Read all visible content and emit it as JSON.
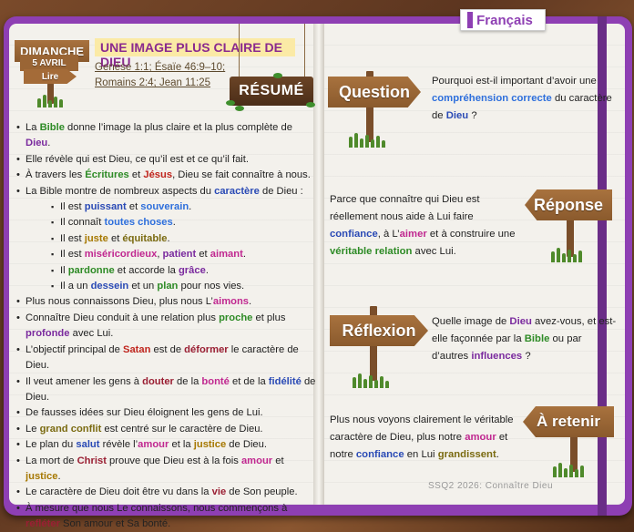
{
  "language_tab": "Français",
  "date_sign": {
    "day": "DIMANCHE",
    "date": "5 AVRIL",
    "action": "Lire"
  },
  "lesson": {
    "title": "UNE IMAGE PLUS CLAIRE DE DIEU",
    "refs_line1": "Genèse 1:1; Ésaïe 46:9–10;",
    "refs_line2": "Romains 2:4; Jean 11:25"
  },
  "resume_label": "RÉSUMÉ",
  "summary": [
    [
      "La ",
      {
        "t": "Bible",
        "c": "green"
      },
      " donne l’image la plus claire et la plus complète de ",
      {
        "t": "Dieu",
        "c": "purple"
      },
      "."
    ],
    [
      "Elle révèle qui est Dieu, ce qu’il est et ce qu’il fait."
    ],
    [
      "À travers les ",
      {
        "t": "Écritures",
        "c": "green"
      },
      " et ",
      {
        "t": "Jésus",
        "c": "red"
      },
      ", Dieu se fait connaître à nous."
    ],
    [
      "La Bible montre de nombreux aspects du ",
      {
        "t": "caractère",
        "c": "blue"
      },
      " de Dieu :"
    ]
  ],
  "attributes": [
    [
      "Il est ",
      {
        "t": "puissant",
        "c": "blue"
      },
      " et ",
      {
        "t": "souverain",
        "c": "lblue"
      },
      "."
    ],
    [
      "Il connaît ",
      {
        "t": "toutes choses",
        "c": "lblue"
      },
      "."
    ],
    [
      "Il est ",
      {
        "t": "juste",
        "c": "gold"
      },
      " et ",
      {
        "t": "équitable",
        "c": "olive"
      },
      "."
    ],
    [
      "Il est ",
      {
        "t": "miséricordieux",
        "c": "pink"
      },
      ", ",
      {
        "t": "patient",
        "c": "purple"
      },
      " et ",
      {
        "t": "aimant",
        "c": "pink"
      },
      "."
    ],
    [
      "Il ",
      {
        "t": "pardonne",
        "c": "green"
      },
      " et accorde la ",
      {
        "t": "grâce",
        "c": "purple"
      },
      "."
    ],
    [
      "Il a un ",
      {
        "t": "dessein",
        "c": "blue"
      },
      " et un ",
      {
        "t": "plan",
        "c": "green"
      },
      " pour nos vies."
    ]
  ],
  "summary2": [
    [
      "Plus nous connaissons Dieu, plus nous L’",
      {
        "t": "aimons",
        "c": "pink"
      },
      "."
    ],
    [
      "Connaître Dieu conduit à une relation plus ",
      {
        "t": "proche",
        "c": "green"
      },
      " et plus ",
      {
        "t": "profonde",
        "c": "purple"
      },
      " avec Lui."
    ],
    [
      "L’objectif principal de ",
      {
        "t": "Satan",
        "c": "red"
      },
      " est de ",
      {
        "t": "déformer",
        "c": "dkred"
      },
      " le caractère de Dieu."
    ],
    [
      "Il veut amener les gens à ",
      {
        "t": "douter",
        "c": "dkred"
      },
      " de la ",
      {
        "t": "bonté",
        "c": "pink"
      },
      " et de la ",
      {
        "t": "fidélité",
        "c": "blue"
      },
      " de Dieu."
    ],
    [
      "De fausses idées sur Dieu éloignent les gens de Lui."
    ],
    [
      "Le ",
      {
        "t": "grand conflit",
        "c": "olive"
      },
      " est centré sur le caractère de Dieu."
    ],
    [
      "Le plan du ",
      {
        "t": "salut",
        "c": "blue"
      },
      " révèle l’",
      {
        "t": "amour",
        "c": "pink"
      },
      " et la ",
      {
        "t": "justice",
        "c": "gold"
      },
      " de Dieu."
    ],
    [
      "La mort de ",
      {
        "t": "Christ",
        "c": "dkred"
      },
      " prouve que Dieu est à la fois ",
      {
        "t": "amour",
        "c": "pink"
      },
      " et ",
      {
        "t": "justice",
        "c": "gold"
      },
      "."
    ],
    [
      "Le caractère de Dieu doit être vu dans la ",
      {
        "t": "vie",
        "c": "dkred"
      },
      " de Son peuple."
    ],
    [
      "À mesure que nous Le connaissons, nous commençons à ",
      {
        "t": "refléter",
        "c": "dkred"
      },
      " Son amour et Sa bonté."
    ]
  ],
  "question": {
    "label": "Question",
    "text": [
      "Pourquoi est-il important d’avoir une ",
      {
        "t": "compréhension correcte",
        "c": "lblue"
      },
      " du caractère de ",
      {
        "t": "Dieu",
        "c": "blue"
      },
      " ?"
    ]
  },
  "reponse": {
    "label": "Réponse",
    "text": [
      "Parce que connaître qui Dieu est réellement nous aide à Lui faire ",
      {
        "t": "confiance",
        "c": "blue"
      },
      ", à L’",
      {
        "t": "aimer",
        "c": "pink"
      },
      " et à construire une ",
      {
        "t": "véritable relation",
        "c": "green"
      },
      " avec Lui."
    ]
  },
  "reflexion": {
    "label": "Réflexion",
    "text": [
      "Quelle image de ",
      {
        "t": "Dieu",
        "c": "purple"
      },
      " avez-vous, et est-elle façonnée par la ",
      {
        "t": "Bible",
        "c": "green"
      },
      " ou par d’autres ",
      {
        "t": "influences",
        "c": "purple"
      },
      " ?"
    ]
  },
  "retenir": {
    "label": "À retenir",
    "text": [
      "Plus nous voyons clairement le véritable caractère de Dieu, plus notre ",
      {
        "t": "amour",
        "c": "pink"
      },
      " et notre ",
      {
        "t": "confiance",
        "c": "blue"
      },
      " en Lui ",
      {
        "t": "grandissent",
        "c": "olive"
      },
      "."
    ]
  },
  "footer": "SSQ2 2026: Connaître Dieu"
}
